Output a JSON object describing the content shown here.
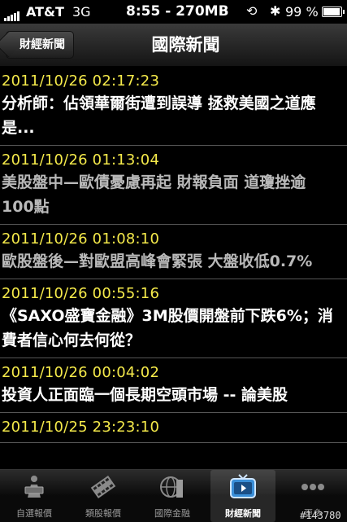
{
  "status_bar": {
    "carrier": "AT&T",
    "network": "3G",
    "time": "8:55 - 270MB",
    "battery": "99 %"
  },
  "navbar": {
    "back_label": "財經新聞",
    "title": "國際新聞"
  },
  "news": [
    {
      "date": "2011/10/26 02:17:23",
      "title": "分析師：佔領華爾街遭到誤導 拯救美國之道應是...",
      "read": false
    },
    {
      "date": "2011/10/26 01:13:04",
      "title": "美股盤中—歐債憂慮再起 財報負面 道瓊挫逾100點",
      "read": true
    },
    {
      "date": "2011/10/26 01:08:10",
      "title": "歐股盤後—對歐盟高峰會緊張 大盤收低0.7%",
      "read": true
    },
    {
      "date": "2011/10/26 00:55:16",
      "title": "《SAXO盛寶金融》3M股價開盤前下跌6%；消費者信心何去何從？",
      "read": false
    },
    {
      "date": "2011/10/26 00:04:02",
      "title": "投資人正面臨一個長期空頭市場 -- 論美股",
      "read": false
    },
    {
      "date": "2011/10/25 23:23:10",
      "title": "",
      "read": false
    }
  ],
  "tabs": [
    {
      "label": "自選報價",
      "icon": "person-reading-icon"
    },
    {
      "label": "類股報價",
      "icon": "film-grid-icon"
    },
    {
      "label": "國際金融",
      "icon": "globe-building-icon"
    },
    {
      "label": "財經新聞",
      "icon": "tv-icon"
    },
    {
      "label": "更多",
      "icon": "more-dots-icon"
    }
  ],
  "watermark": "#143780",
  "colors": {
    "date": "#f4e94a",
    "accent_tab": "#3a8fd8"
  }
}
